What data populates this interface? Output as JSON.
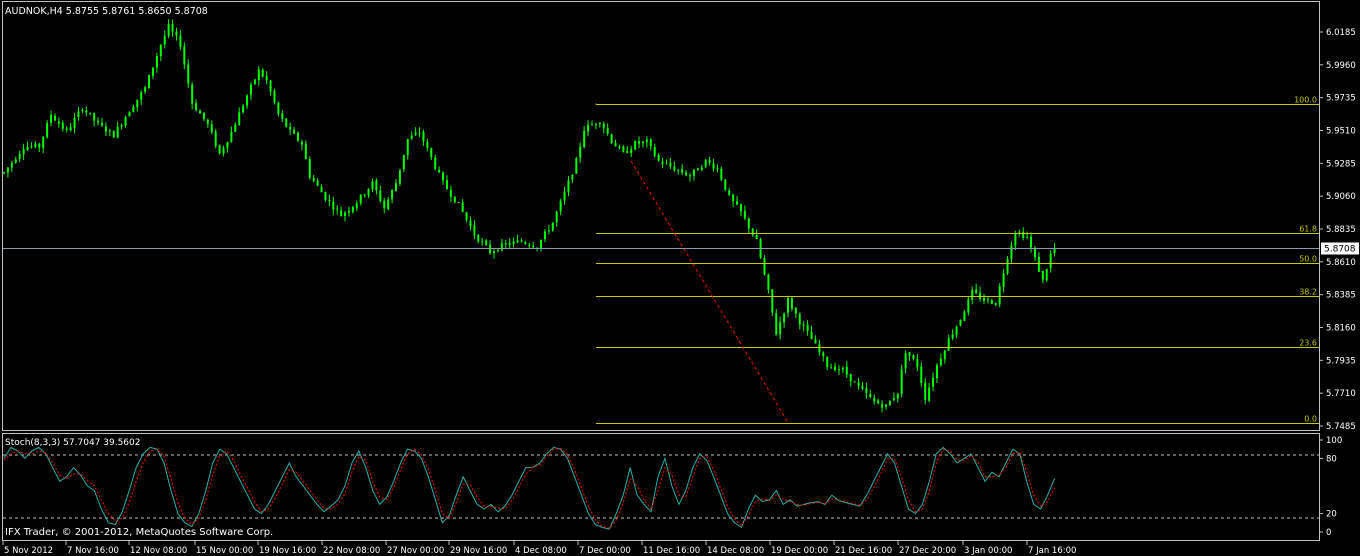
{
  "window": {
    "symbol_header": "AUDNOK,H4  5.8755 5.8761 5.8650 5.8708",
    "copyright": "IFX Trader, © 2001-2012, MetaQuotes Software Corp."
  },
  "colors": {
    "background": "#000000",
    "frame": "#c0c0c0",
    "candle": "#00ff00",
    "fib": "#c8c800",
    "trend": "#ff0000",
    "bid_line": "#8a9ab0",
    "stoch_main": "#20b2aa",
    "stoch_signal": "#ff0000",
    "text": "#ffffff"
  },
  "chart_data": [
    {
      "type": "candlestick",
      "title": "AUDNOK,H4",
      "ohlc_header": [
        "5.8755",
        "5.8761",
        "5.8650",
        "5.8708"
      ],
      "current_price": "5.8708",
      "ylim": [
        5.7485,
        6.0185
      ],
      "y_ticks": [
        "6.0185",
        "5.9960",
        "5.9735",
        "5.9510",
        "5.9285",
        "5.9060",
        "5.8835",
        "5.8610",
        "5.8385",
        "5.8160",
        "5.7935",
        "5.7710",
        "5.7485"
      ],
      "x_ticks": [
        "5 Nov 2012",
        "7 Nov 16:00",
        "12 Nov 08:00",
        "15 Nov 00:00",
        "19 Nov 16:00",
        "22 Nov 08:00",
        "27 Nov 00:00",
        "29 Nov 16:00",
        "4 Dec 08:00",
        "7 Dec 00:00",
        "11 Dec 16:00",
        "14 Dec 08:00",
        "19 Dec 00:00",
        "21 Dec 16:00",
        "27 Dec 20:00",
        "3 Jan 00:00",
        "7 Jan 16:00"
      ],
      "price_path": [
        [
          0,
          5.922
        ],
        [
          5,
          5.94
        ],
        [
          9,
          5.94
        ],
        [
          12,
          5.962
        ],
        [
          16,
          5.95
        ],
        [
          20,
          5.967
        ],
        [
          24,
          5.955
        ],
        [
          28,
          5.948
        ],
        [
          32,
          5.965
        ],
        [
          36,
          5.98
        ],
        [
          40,
          6.01
        ],
        [
          42,
          6.022
        ],
        [
          45,
          6.01
        ],
        [
          48,
          5.97
        ],
        [
          52,
          5.955
        ],
        [
          55,
          5.935
        ],
        [
          58,
          5.95
        ],
        [
          62,
          5.975
        ],
        [
          65,
          5.992
        ],
        [
          67,
          5.985
        ],
        [
          70,
          5.962
        ],
        [
          73,
          5.95
        ],
        [
          76,
          5.942
        ],
        [
          78,
          5.92
        ],
        [
          82,
          5.905
        ],
        [
          86,
          5.893
        ],
        [
          90,
          5.902
        ],
        [
          94,
          5.915
        ],
        [
          97,
          5.898
        ],
        [
          100,
          5.915
        ],
        [
          103,
          5.945
        ],
        [
          106,
          5.95
        ],
        [
          109,
          5.932
        ],
        [
          112,
          5.915
        ],
        [
          116,
          5.9
        ],
        [
          120,
          5.88
        ],
        [
          124,
          5.868
        ],
        [
          128,
          5.873
        ],
        [
          132,
          5.875
        ],
        [
          136,
          5.872
        ],
        [
          140,
          5.888
        ],
        [
          143,
          5.908
        ],
        [
          146,
          5.93
        ],
        [
          148,
          5.952
        ],
        [
          152,
          5.958
        ],
        [
          155,
          5.944
        ],
        [
          158,
          5.935
        ],
        [
          161,
          5.942
        ],
        [
          164,
          5.943
        ],
        [
          167,
          5.93
        ],
        [
          171,
          5.925
        ],
        [
          175,
          5.92
        ],
        [
          179,
          5.93
        ],
        [
          182,
          5.925
        ],
        [
          185,
          5.905
        ],
        [
          188,
          5.895
        ],
        [
          192,
          5.875
        ],
        [
          195,
          5.84
        ],
        [
          197,
          5.812
        ],
        [
          200,
          5.835
        ],
        [
          203,
          5.82
        ],
        [
          206,
          5.808
        ],
        [
          210,
          5.79
        ],
        [
          214,
          5.787
        ],
        [
          218,
          5.775
        ],
        [
          222,
          5.765
        ],
        [
          225,
          5.762
        ],
        [
          228,
          5.772
        ],
        [
          230,
          5.8
        ],
        [
          233,
          5.79
        ],
        [
          235,
          5.768
        ],
        [
          238,
          5.79
        ],
        [
          241,
          5.808
        ],
        [
          244,
          5.822
        ],
        [
          247,
          5.84
        ],
        [
          250,
          5.835
        ],
        [
          253,
          5.833
        ],
        [
          256,
          5.865
        ],
        [
          258,
          5.882
        ],
        [
          261,
          5.878
        ],
        [
          263,
          5.863
        ],
        [
          265,
          5.848
        ],
        [
          267,
          5.866
        ],
        [
          268,
          5.87
        ]
      ],
      "fibonacci": {
        "levels": [
          {
            "label": "100.0",
            "price": 5.9695
          },
          {
            "label": "61.8",
            "price": 5.8808
          },
          {
            "label": "50.0",
            "price": 5.8605
          },
          {
            "label": "38.2",
            "price": 5.8375
          },
          {
            "label": "23.6",
            "price": 5.8025
          },
          {
            "label": "0.0",
            "price": 5.7505
          }
        ],
        "start_bar": 151
      },
      "trend_line": [
        [
          160,
          5.93
        ],
        [
          200,
          5.751
        ]
      ],
      "bars_count": 269
    },
    {
      "type": "line",
      "title": "Stoch(8,3,3) 57.7047 39.5602",
      "ylim": [
        0,
        100
      ],
      "y_ticks": [
        "100",
        "80",
        "20",
        "0"
      ],
      "levels": [
        80,
        20
      ],
      "series": [
        {
          "name": "main",
          "values": [
            80,
            92,
            88,
            80,
            88,
            92,
            85,
            70,
            55,
            60,
            70,
            62,
            50,
            45,
            25,
            10,
            8,
            22,
            45,
            70,
            85,
            92,
            90,
            75,
            45,
            20,
            10,
            6,
            20,
            45,
            75,
            90,
            85,
            70,
            55,
            40,
            25,
            20,
            30,
            45,
            60,
            75,
            60,
            50,
            40,
            30,
            22,
            28,
            35,
            50,
            75,
            88,
            70,
            45,
            30,
            38,
            55,
            75,
            90,
            88,
            80,
            60,
            35,
            10,
            18,
            40,
            60,
            45,
            30,
            25,
            30,
            22,
            28,
            40,
            55,
            70,
            70,
            75,
            85,
            92,
            90,
            80,
            60,
            40,
            20,
            8,
            5,
            3,
            20,
            40,
            70,
            40,
            30,
            22,
            60,
            80,
            50,
            30,
            45,
            70,
            85,
            78,
            60,
            40,
            20,
            10,
            5,
            25,
            40,
            33,
            35,
            45,
            30,
            35,
            28,
            30,
            32,
            33,
            30,
            40,
            34,
            32,
            30,
            28,
            40,
            55,
            70,
            85,
            75,
            50,
            25,
            20,
            30,
            55,
            85,
            92,
            85,
            75,
            80,
            85,
            70,
            55,
            65,
            60,
            75,
            90,
            85,
            55,
            30,
            25,
            40,
            58
          ]
        },
        {
          "name": "signal",
          "values": [
            78,
            85,
            88,
            85,
            85,
            88,
            86,
            75,
            62,
            58,
            63,
            63,
            56,
            50,
            35,
            20,
            12,
            15,
            32,
            55,
            75,
            88,
            90,
            82,
            58,
            32,
            15,
            8,
            15,
            35,
            62,
            83,
            88,
            78,
            62,
            48,
            33,
            22,
            25,
            37,
            52,
            68,
            65,
            55,
            45,
            35,
            26,
            25,
            30,
            42,
            65,
            82,
            78,
            55,
            38,
            35,
            48,
            68,
            85,
            90,
            84,
            68,
            45,
            20,
            15,
            32,
            52,
            52,
            38,
            28,
            28,
            26,
            25,
            34,
            48,
            63,
            70,
            73,
            82,
            90,
            91,
            84,
            68,
            48,
            28,
            13,
            6,
            4,
            13,
            32,
            58,
            50,
            35,
            25,
            45,
            70,
            62,
            40,
            38,
            60,
            80,
            82,
            68,
            48,
            28,
            14,
            7,
            18,
            33,
            36,
            34,
            40,
            36,
            33,
            30,
            29,
            31,
            32,
            31,
            36,
            35,
            33,
            31,
            29,
            35,
            48,
            63,
            80,
            80,
            60,
            35,
            22,
            25,
            45,
            75,
            90,
            88,
            78,
            78,
            83,
            76,
            60,
            60,
            62,
            70,
            85,
            87,
            65,
            40,
            28,
            33,
            48
          ]
        }
      ]
    }
  ]
}
